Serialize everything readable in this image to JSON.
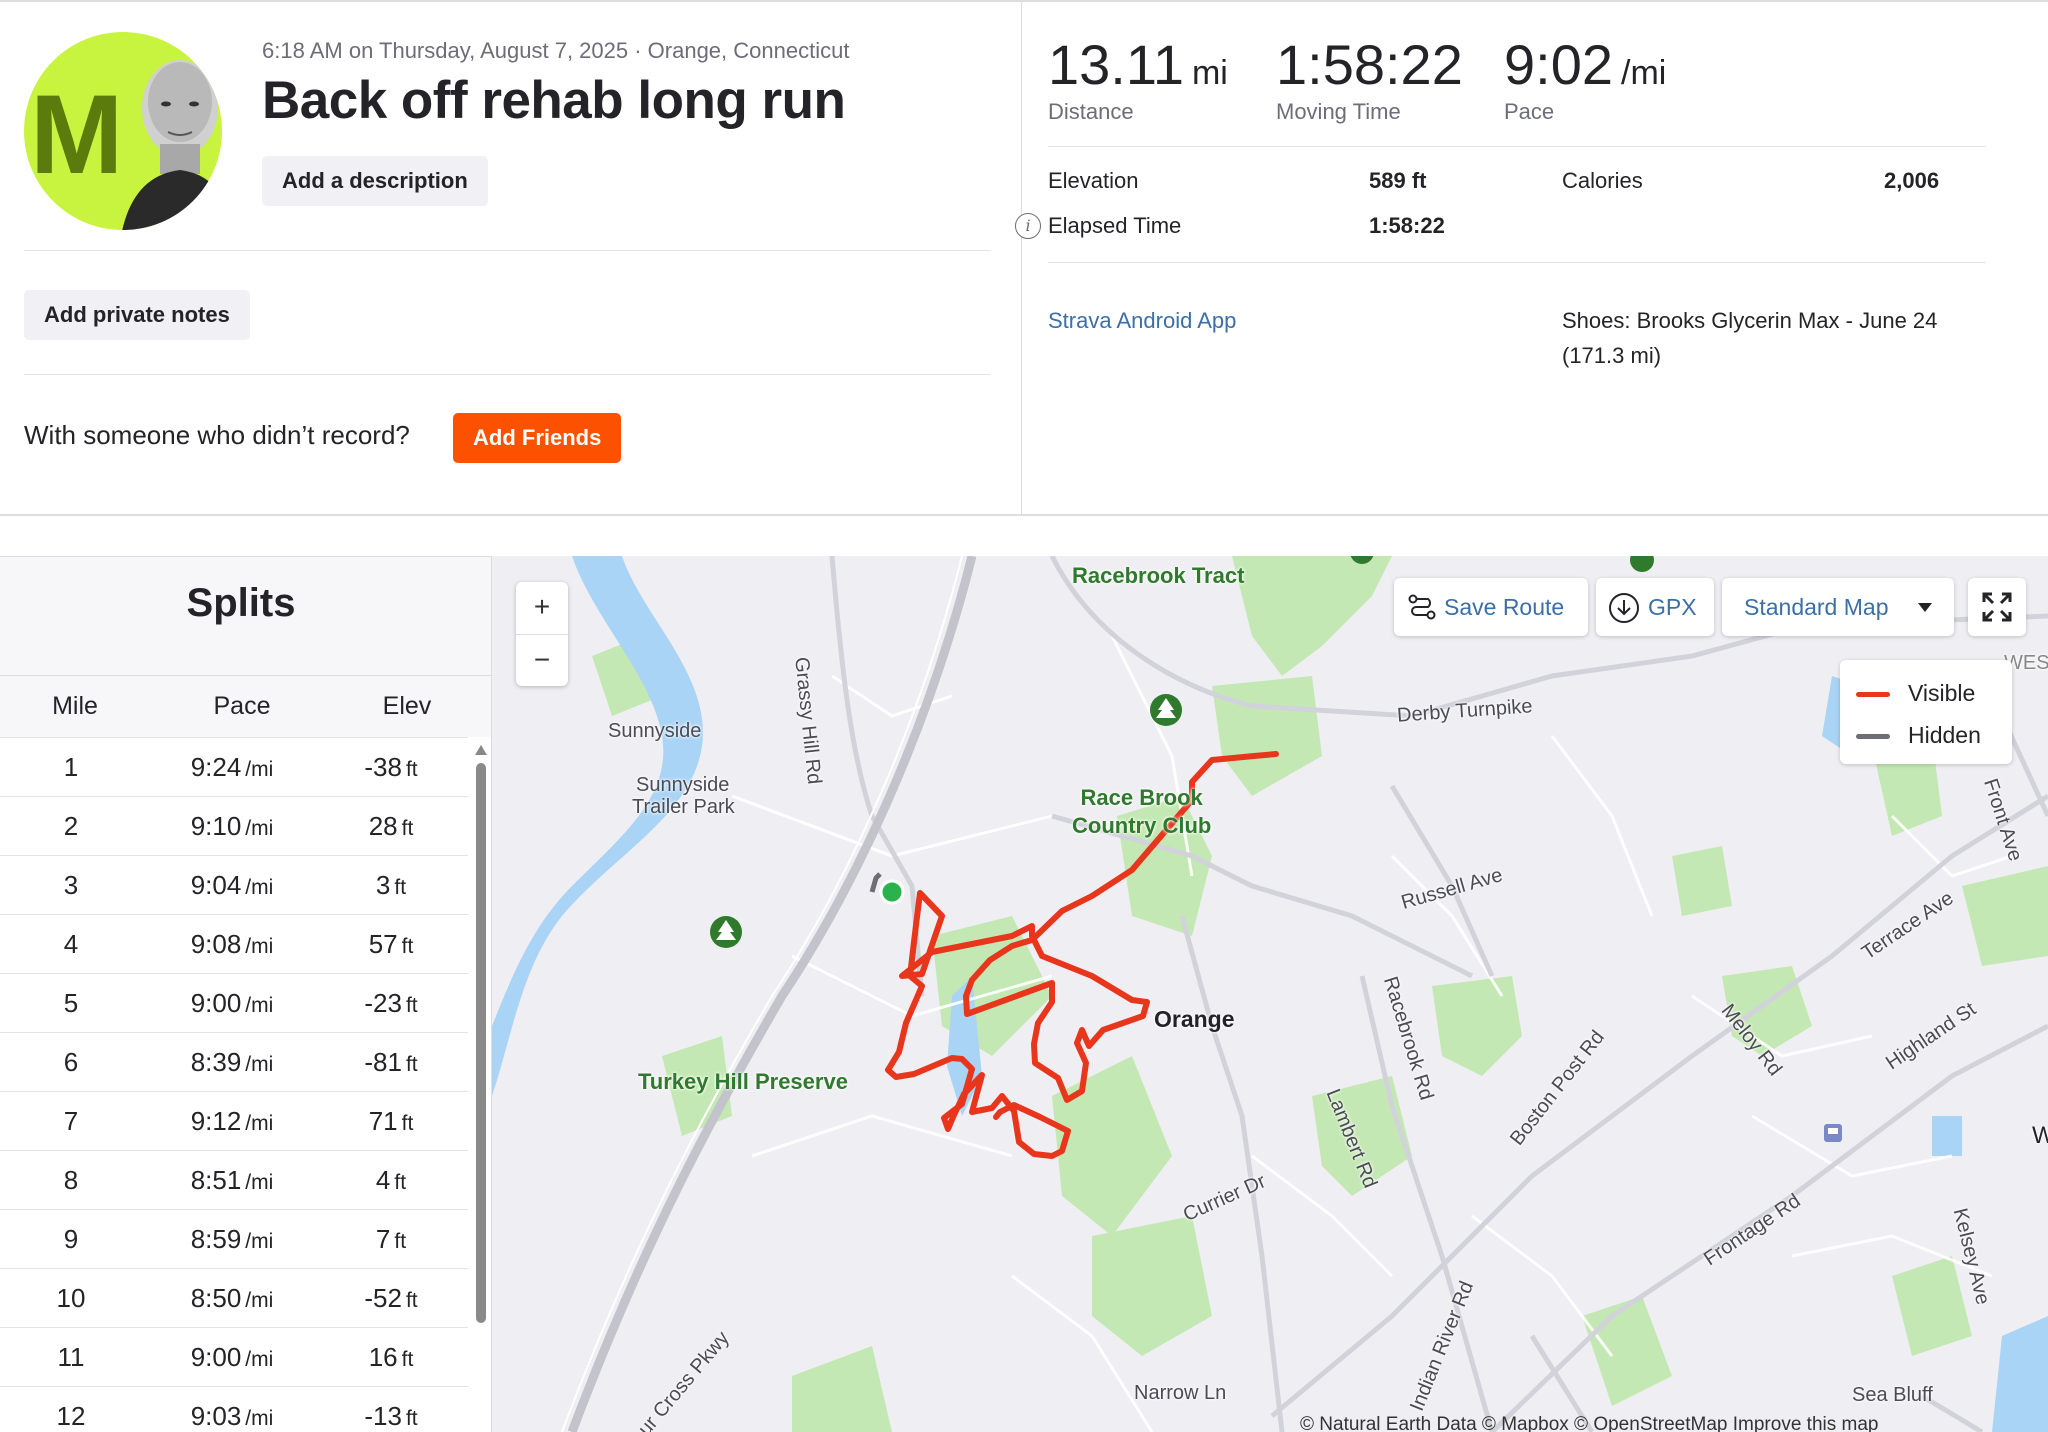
{
  "activity": {
    "datetime_location": "6:18 AM on Thursday, August 7, 2025 · Orange, Connecticut",
    "title": "Back off rehab long run",
    "avatar_letter": "M",
    "add_description_label": "Add a description",
    "add_private_notes_label": "Add private notes",
    "with_someone_text": "With someone who didn’t record?",
    "add_friends_label": "Add Friends"
  },
  "stats": {
    "distance": {
      "value": "13.11",
      "unit": "mi",
      "label": "Distance"
    },
    "moving_time": {
      "value": "1:58:22",
      "label": "Moving Time"
    },
    "pace": {
      "value": "9:02",
      "unit": "/mi",
      "label": "Pace"
    },
    "elevation_label": "Elevation",
    "elevation_value": "589 ft",
    "calories_label": "Calories",
    "calories_value": "2,006",
    "elapsed_label": "Elapsed Time",
    "elapsed_value": "1:58:22",
    "device": "Strava Android App",
    "shoes_line1": "Shoes: Brooks Glycerin Max - June 24",
    "shoes_line2": "(171.3 mi)"
  },
  "splits": {
    "title": "Splits",
    "headers": {
      "mile": "Mile",
      "pace": "Pace",
      "elev": "Elev"
    },
    "pace_unit": "/mi",
    "elev_unit": "ft",
    "rows": [
      {
        "mile": "1",
        "pace": "9:24",
        "elev": "-38"
      },
      {
        "mile": "2",
        "pace": "9:10",
        "elev": "28"
      },
      {
        "mile": "3",
        "pace": "9:04",
        "elev": "3"
      },
      {
        "mile": "4",
        "pace": "9:08",
        "elev": "57"
      },
      {
        "mile": "5",
        "pace": "9:00",
        "elev": "-23"
      },
      {
        "mile": "6",
        "pace": "8:39",
        "elev": "-81"
      },
      {
        "mile": "7",
        "pace": "9:12",
        "elev": "71"
      },
      {
        "mile": "8",
        "pace": "8:51",
        "elev": "4"
      },
      {
        "mile": "9",
        "pace": "8:59",
        "elev": "7"
      },
      {
        "mile": "10",
        "pace": "8:50",
        "elev": "-52"
      },
      {
        "mile": "11",
        "pace": "9:00",
        "elev": "16"
      },
      {
        "mile": "12",
        "pace": "9:03",
        "elev": "-13"
      }
    ]
  },
  "map": {
    "save_route_label": "Save Route",
    "gpx_label": "GPX",
    "map_style_label": "Standard Map",
    "legend_visible": "Visible",
    "legend_hidden": "Hidden",
    "zoom_in": "+",
    "zoom_out": "−",
    "town": "Orange",
    "labels": {
      "sunnyside": "Sunnyside",
      "sunnyside_trailer_1": "Sunnyside",
      "sunnyside_trailer_2": "Trailer Park",
      "grassy_hill": "Grassy Hill Rd",
      "derby": "Derby Turnpike",
      "russell": "Russell Ave",
      "racebrook_rd": "Racebrook Rd",
      "lambert": "Lambert Rd",
      "boston_post": "Boston Post Rd",
      "meloy": "Meloy Rd",
      "terrace": "Terrace Ave",
      "highland": "Highland St",
      "frontage": "Frontage Rd",
      "kelsey": "Kelsey Ave",
      "front_ave": "Front Ave",
      "indian_river": "Indian River Rd",
      "narrow": "Narrow Ln",
      "currier": "Currier Dr",
      "cross_pkwy": "ur Cross Pkwy",
      "sea_bluff": "Sea Bluff",
      "racebrook_tract": "Racebrook Tract",
      "st": "st",
      "wes": "WES",
      "w": "W"
    },
    "parks": {
      "race_brook_1": "Race Brook",
      "race_brook_2": "Country Club",
      "turkey_hill": "Turkey Hill Preserve"
    },
    "attribution": "© Natural Earth Data © Mapbox © OpenStreetMap Improve this map",
    "colors": {
      "route_visible": "#e8361d",
      "route_hidden": "#6d6d78",
      "park": "#b6e2a6",
      "water": "#a8d3f5",
      "start": "#2bb34b"
    }
  },
  "icons": [
    "info-icon",
    "save-route-icon",
    "download-icon",
    "chevron-down-icon",
    "fullscreen-icon",
    "tree-icon",
    "rail-icon"
  ]
}
